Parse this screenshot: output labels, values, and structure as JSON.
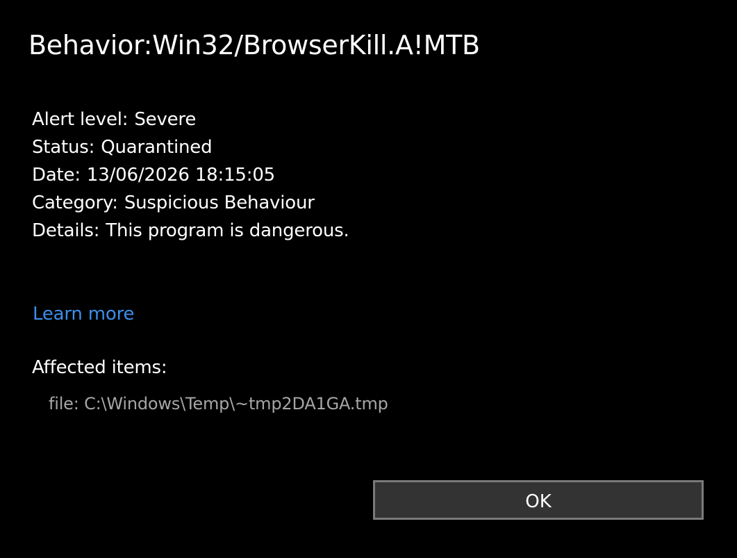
{
  "dialog": {
    "title": "Behavior:Win32/BrowserKill.A!MTB"
  },
  "details": [
    {
      "label": "Alert level:",
      "value": "Severe"
    },
    {
      "label": "Status:",
      "value": "Quarantined"
    },
    {
      "label": "Date:",
      "value": "13/06/2026 18:15:05"
    },
    {
      "label": "Category:",
      "value": "Suspicious Behaviour"
    },
    {
      "label": "Details:",
      "value": "This program is dangerous."
    }
  ],
  "learn_more": "Learn more",
  "affected": {
    "heading": "Affected items:",
    "items": [
      "file: C:\\Windows\\Temp\\~tmp2DA1GA.tmp"
    ]
  },
  "buttons": {
    "ok_label": "OK"
  },
  "colors": {
    "background": "#000000",
    "text": "#ffffff",
    "link": "#3c8ee8",
    "muted_text": "#a6a6a6",
    "button_bg": "#333333",
    "button_border": "#7a7a7a"
  }
}
